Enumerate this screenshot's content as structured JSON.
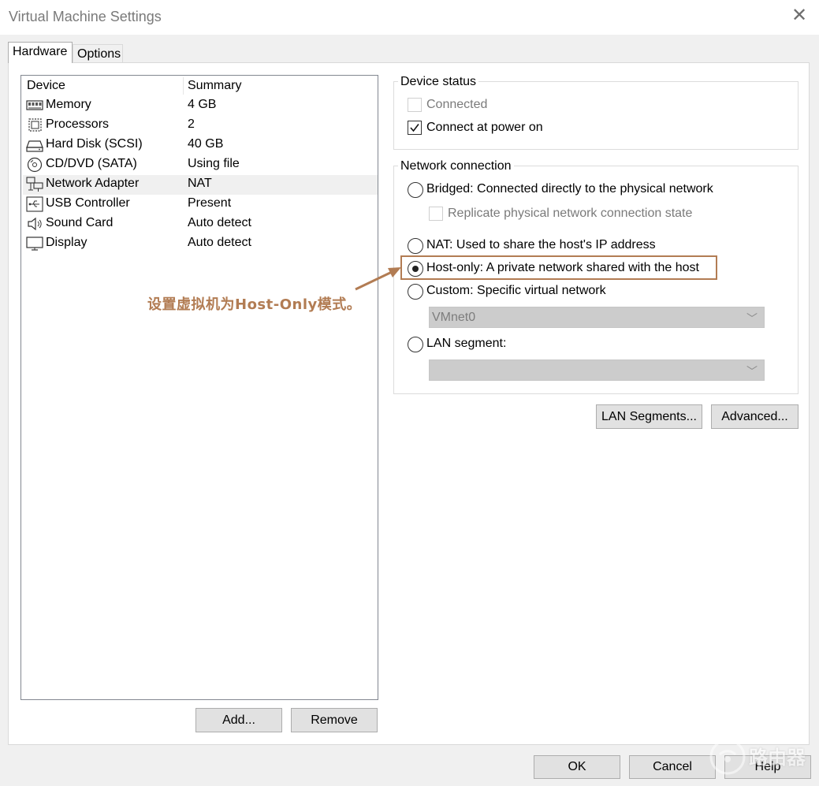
{
  "window": {
    "title": "Virtual Machine Settings"
  },
  "tabs": [
    {
      "label": "Hardware",
      "active": true
    },
    {
      "label": "Options",
      "active": false
    }
  ],
  "device_table": {
    "headers": {
      "device": "Device",
      "summary": "Summary"
    },
    "rows": [
      {
        "icon": "memory-icon",
        "device": "Memory",
        "summary": "4 GB",
        "selected": false
      },
      {
        "icon": "processor-icon",
        "device": "Processors",
        "summary": "2",
        "selected": false
      },
      {
        "icon": "hard-disk-icon",
        "device": "Hard Disk (SCSI)",
        "summary": "40 GB",
        "selected": false
      },
      {
        "icon": "cd-dvd-icon",
        "device": "CD/DVD (SATA)",
        "summary": "Using file",
        "selected": false
      },
      {
        "icon": "network-adapter-icon",
        "device": "Network Adapter",
        "summary": "NAT",
        "selected": true
      },
      {
        "icon": "usb-icon",
        "device": "USB Controller",
        "summary": "Present",
        "selected": false
      },
      {
        "icon": "speaker-icon",
        "device": "Sound Card",
        "summary": "Auto detect",
        "selected": false
      },
      {
        "icon": "display-icon",
        "device": "Display",
        "summary": "Auto detect",
        "selected": false
      }
    ],
    "add_label": "Add...",
    "remove_label": "Remove"
  },
  "device_status": {
    "legend": "Device status",
    "connected": {
      "label": "Connected",
      "checked": false,
      "enabled": false
    },
    "connect_at_power_on": {
      "label": "Connect at power on",
      "checked": true,
      "enabled": true
    }
  },
  "network_connection": {
    "legend": "Network connection",
    "bridged": {
      "label": "Bridged: Connected directly to the physical network",
      "selected": false
    },
    "replicate": {
      "label": "Replicate physical network connection state",
      "checked": false,
      "enabled": false
    },
    "nat": {
      "label": "NAT: Used to share the host's IP address",
      "selected": false
    },
    "host_only": {
      "label": "Host-only: A private network shared with the host",
      "selected": true
    },
    "custom": {
      "label": "Custom: Specific virtual network",
      "selected": false
    },
    "custom_combo_value": "VMnet0",
    "lan_segment": {
      "label": "LAN segment:",
      "selected": false
    },
    "lan_combo_value": ""
  },
  "buttons": {
    "lan_segments": "LAN Segments...",
    "advanced": "Advanced...",
    "ok": "OK",
    "cancel": "Cancel",
    "help": "Help"
  },
  "annotation": {
    "text": "设置虚拟机为Host-Only模式。",
    "color": "#b27c53"
  },
  "watermark": {
    "text": "路由器"
  }
}
